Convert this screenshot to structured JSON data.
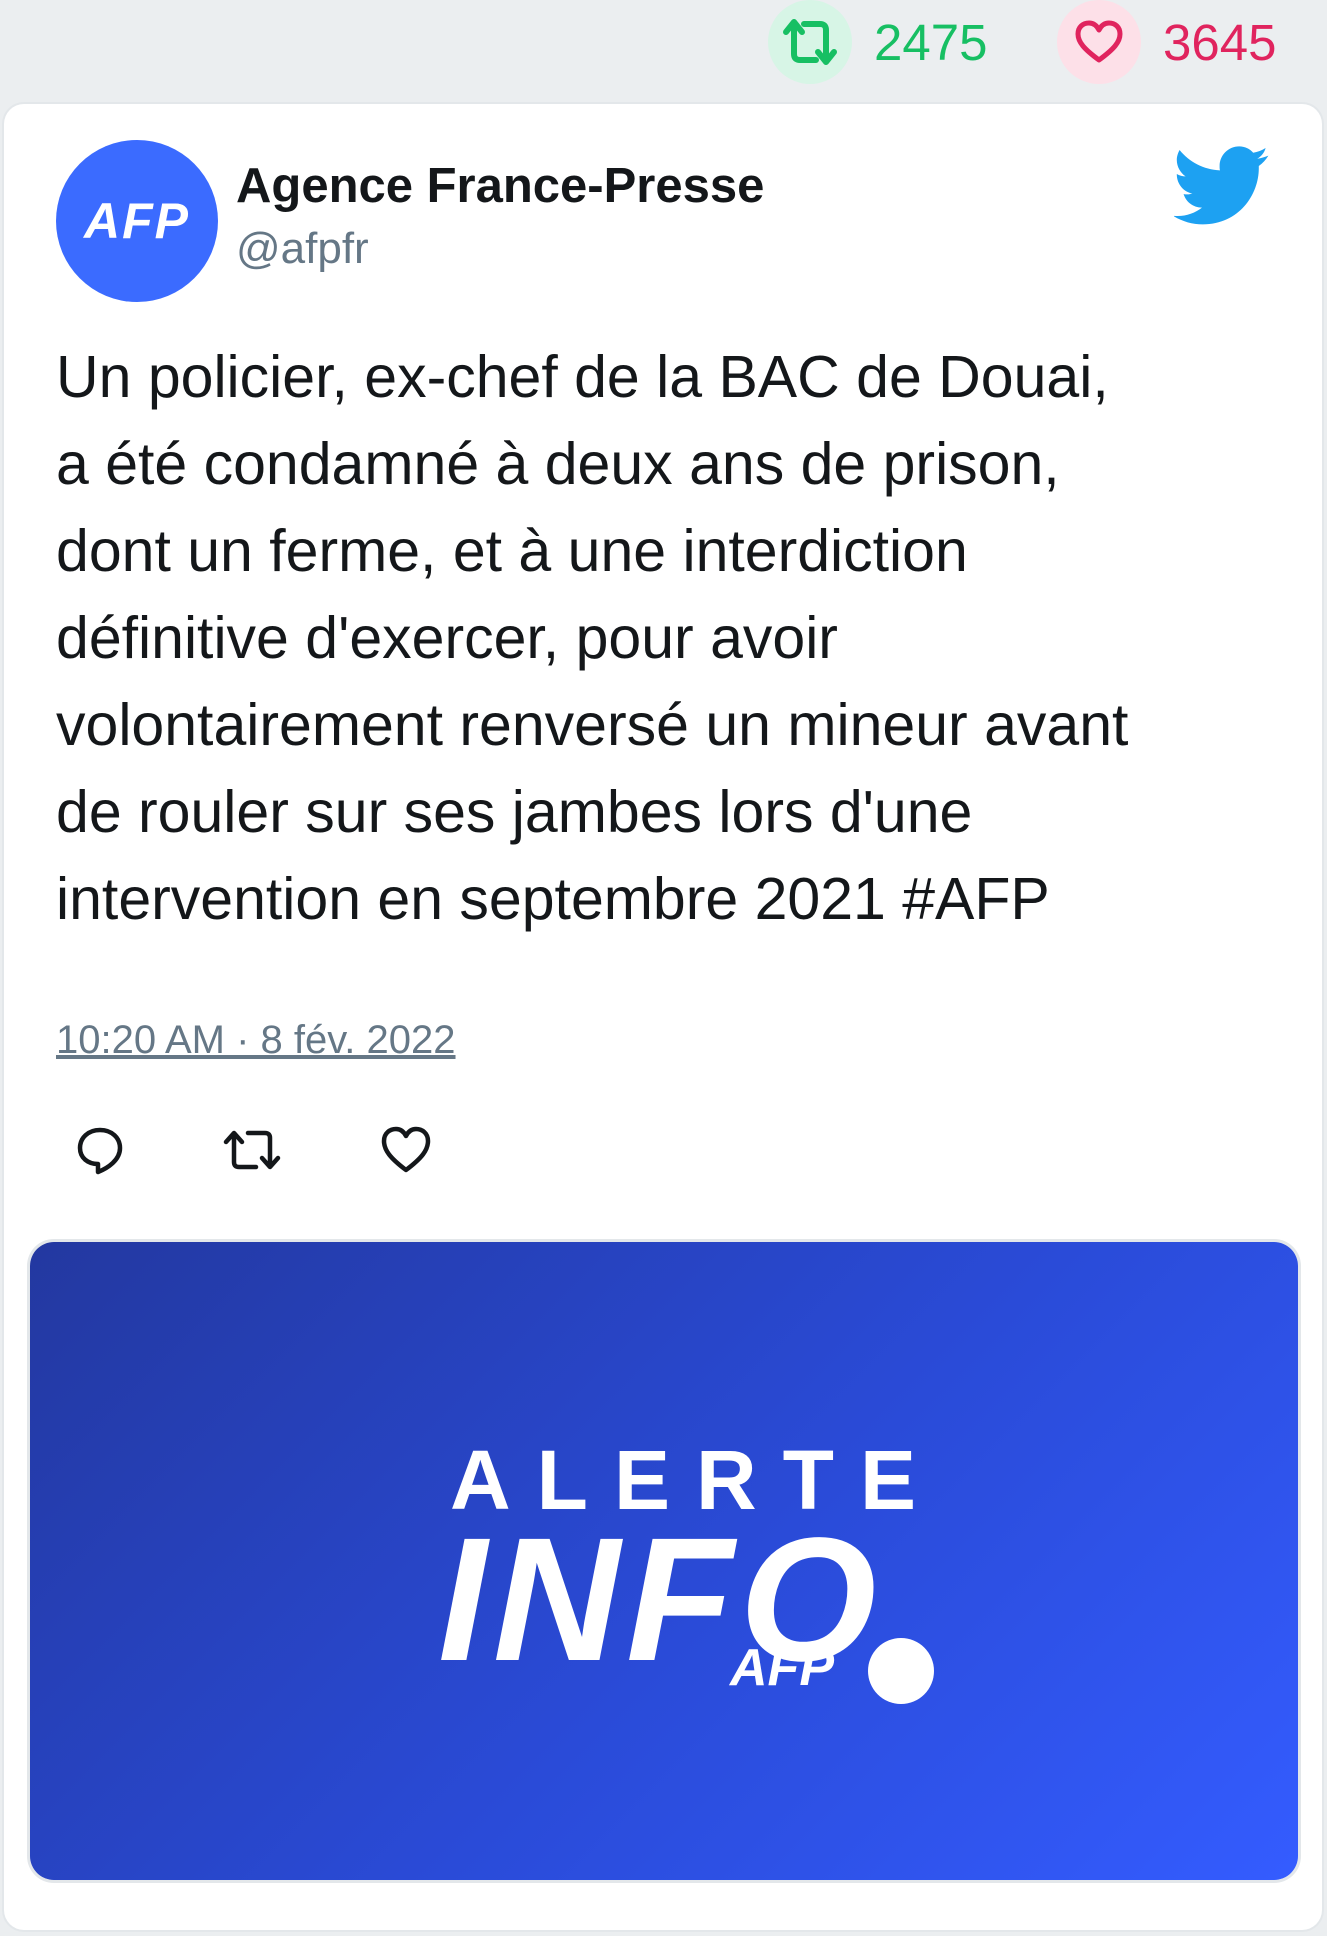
{
  "stats": {
    "retweets": "2475",
    "likes": "3645"
  },
  "author": {
    "avatar_text": "AFP",
    "name": "Agence France-Presse",
    "handle": "@afpfr"
  },
  "tweet": {
    "text": "Un policier, ex-chef de la BAC de Douai,\na été condamné à deux ans de prison,\ndont un ferme, et à une interdiction\ndéfinitive d'exercer, pour avoir\nvolontairement renversé un mineur avant\nde rouler sur ses jambes lors d'une\nintervention en septembre 2021 #AFP",
    "timestamp": "10:20 AM · 8 fév. 2022"
  },
  "media": {
    "line1": "ALERTE",
    "line2": "INFO",
    "brand": "AFP"
  },
  "colors": {
    "retweet_green": "#17bf63",
    "like_red": "#e0245e",
    "twitter_blue": "#1da1f2",
    "afp_blue": "#3b6bff"
  },
  "icons": {
    "retweet": "retweet-icon",
    "like": "heart-icon",
    "reply": "reply-icon",
    "brand": "twitter-bird-icon"
  }
}
